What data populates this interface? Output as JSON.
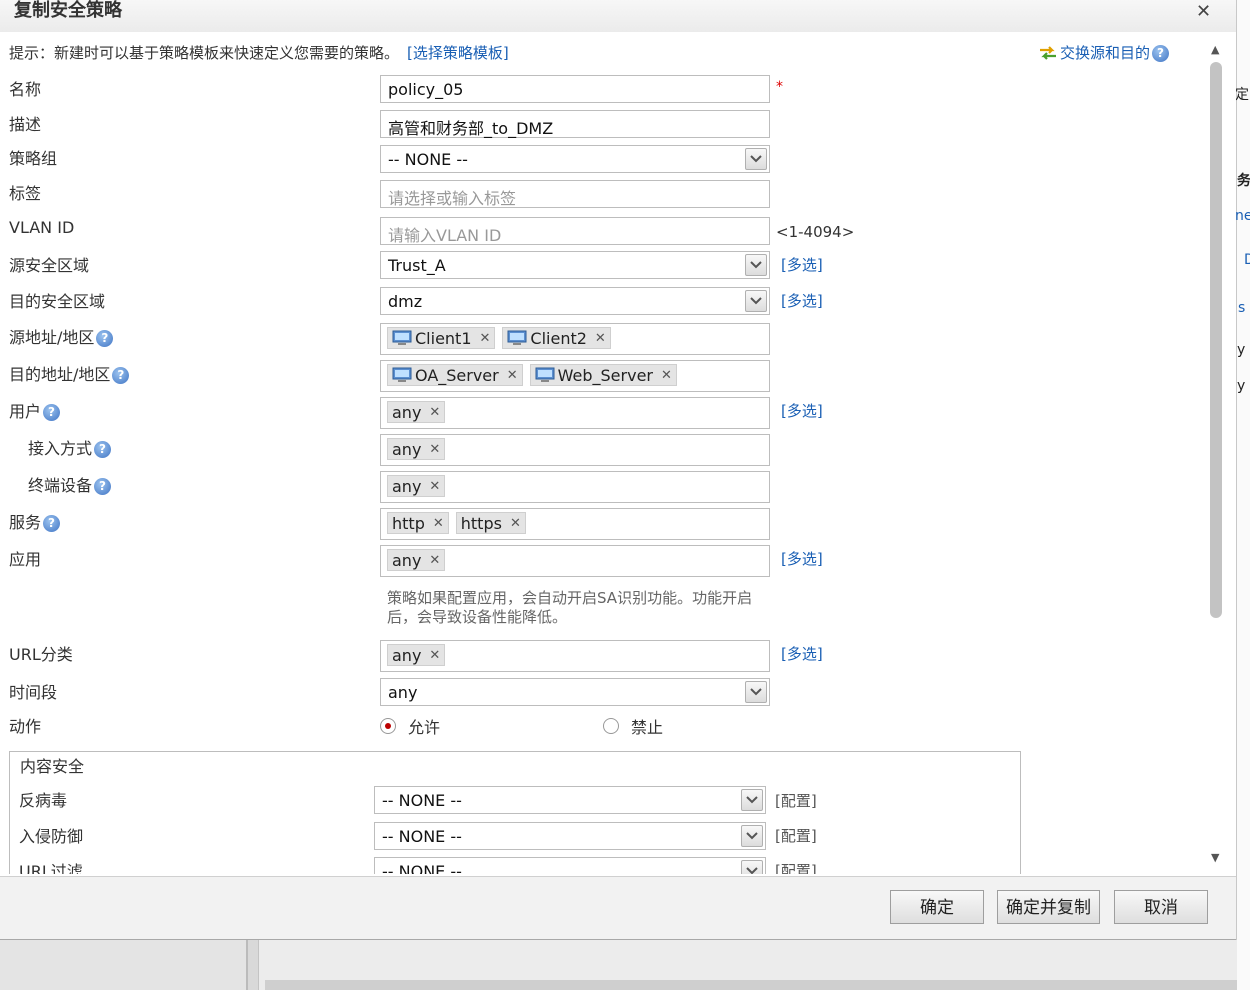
{
  "dialog": {
    "title": "复制安全策略"
  },
  "hint": {
    "text": "提示：新建时可以基于策略模板来快速定义您需要的策略。",
    "link": "[选择策略模板]"
  },
  "swap_label": "交换源和目的",
  "form": {
    "name": {
      "label": "名称",
      "value": "policy_05",
      "required_mark": "*"
    },
    "description": {
      "label": "描述",
      "value": "高管和财务部_to_DMZ"
    },
    "policy_group": {
      "label": "策略组",
      "value": "-- NONE --"
    },
    "tag": {
      "label": "标签",
      "placeholder": "请选择或输入标签"
    },
    "vlan": {
      "label": "VLAN ID",
      "placeholder": "请输入VLAN ID",
      "range": "<1-4094>"
    },
    "src_zone": {
      "label": "源安全区域",
      "value": "Trust_A"
    },
    "dst_zone": {
      "label": "目的安全区域",
      "value": "dmz"
    },
    "src_addr": {
      "label": "源地址/地区",
      "items": [
        "Client1",
        "Client2"
      ]
    },
    "dst_addr": {
      "label": "目的地址/地区",
      "items": [
        "OA_Server",
        "Web_Server"
      ]
    },
    "user": {
      "label": "用户",
      "items": [
        "any"
      ]
    },
    "access_mode": {
      "label": "接入方式",
      "items": [
        "any"
      ]
    },
    "terminal": {
      "label": "终端设备",
      "items": [
        "any"
      ]
    },
    "service": {
      "label": "服务",
      "items": [
        "http",
        "https"
      ]
    },
    "application": {
      "label": "应用",
      "items": [
        "any"
      ],
      "note": "策略如果配置应用，会自动开启SA识别功能。功能开启后，会导致设备性能降低。"
    },
    "url_category": {
      "label": "URL分类",
      "items": [
        "any"
      ]
    },
    "time_range": {
      "label": "时间段",
      "value": "any"
    },
    "action": {
      "label": "动作",
      "options": [
        "允许",
        "禁止"
      ],
      "selected": "允许"
    },
    "multi_select": "[多选]"
  },
  "content_security": {
    "legend": "内容安全",
    "antivirus": {
      "label": "反病毒",
      "value": "-- NONE --",
      "config": "[配置]"
    },
    "ips": {
      "label": "入侵防御",
      "value": "-- NONE --",
      "config": "[配置]"
    },
    "url_filter": {
      "label": "URL过滤",
      "value": "-- NONE --",
      "config": "[配置]"
    }
  },
  "buttons": {
    "ok": "确定",
    "ok_copy": "确定并复制",
    "cancel": "取消"
  },
  "background_fragments": [
    "定",
    "务",
    "ne",
    "D",
    "s",
    "y",
    "y"
  ]
}
